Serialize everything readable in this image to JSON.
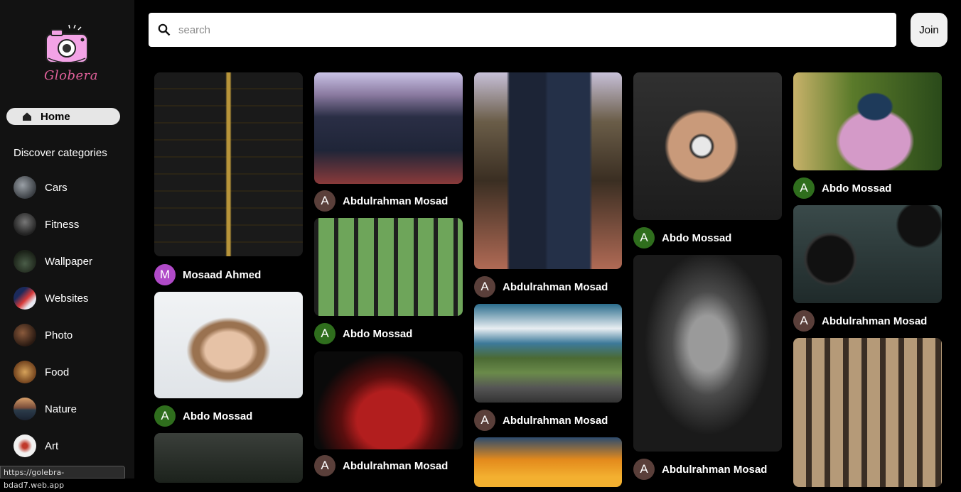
{
  "app": {
    "name": "Globera"
  },
  "search": {
    "placeholder": "search"
  },
  "header": {
    "join_label": "Join"
  },
  "colors": {
    "avatar_M": "#b04ac8",
    "avatar_green": "#2f6e1d",
    "avatar_brown": "#5a3f3a",
    "logo_pink": "#f3a3e6"
  },
  "sidebar": {
    "home_label": "Home",
    "discover_label": "Discover categories",
    "categories": [
      {
        "label": "Cars"
      },
      {
        "label": "Fitness"
      },
      {
        "label": "Wallpaper"
      },
      {
        "label": "Websites"
      },
      {
        "label": "Photo"
      },
      {
        "label": "Food"
      },
      {
        "label": "Nature"
      },
      {
        "label": "Art"
      }
    ]
  },
  "status_bar": {
    "url": "https://golebra-bdad7.web.app"
  },
  "pins": [
    {
      "author": "Mosaad Ahmed",
      "initial": "M"
    },
    {
      "author": "Abdulrahman Mosad",
      "initial": "A"
    },
    {
      "author": "Abdulrahman Mosad",
      "initial": "A"
    },
    {
      "author": "Abdo Mossad",
      "initial": "A"
    },
    {
      "author": "Abdo Mossad",
      "initial": "A"
    },
    {
      "author": "Abdo Mossad",
      "initial": "A"
    },
    {
      "author": "Abdulrahman Mosad",
      "initial": "A"
    },
    {
      "author": "Abdulrahman Mosad",
      "initial": "A"
    },
    {
      "author": "Abdo Mossad",
      "initial": "A"
    },
    {
      "author": "Abdulrahman Mosad",
      "initial": "A"
    },
    {
      "author": "Abdulrahman Mosad",
      "initial": "A"
    },
    {
      "author": "Abdulrahman Mosad",
      "initial": "A"
    }
  ]
}
